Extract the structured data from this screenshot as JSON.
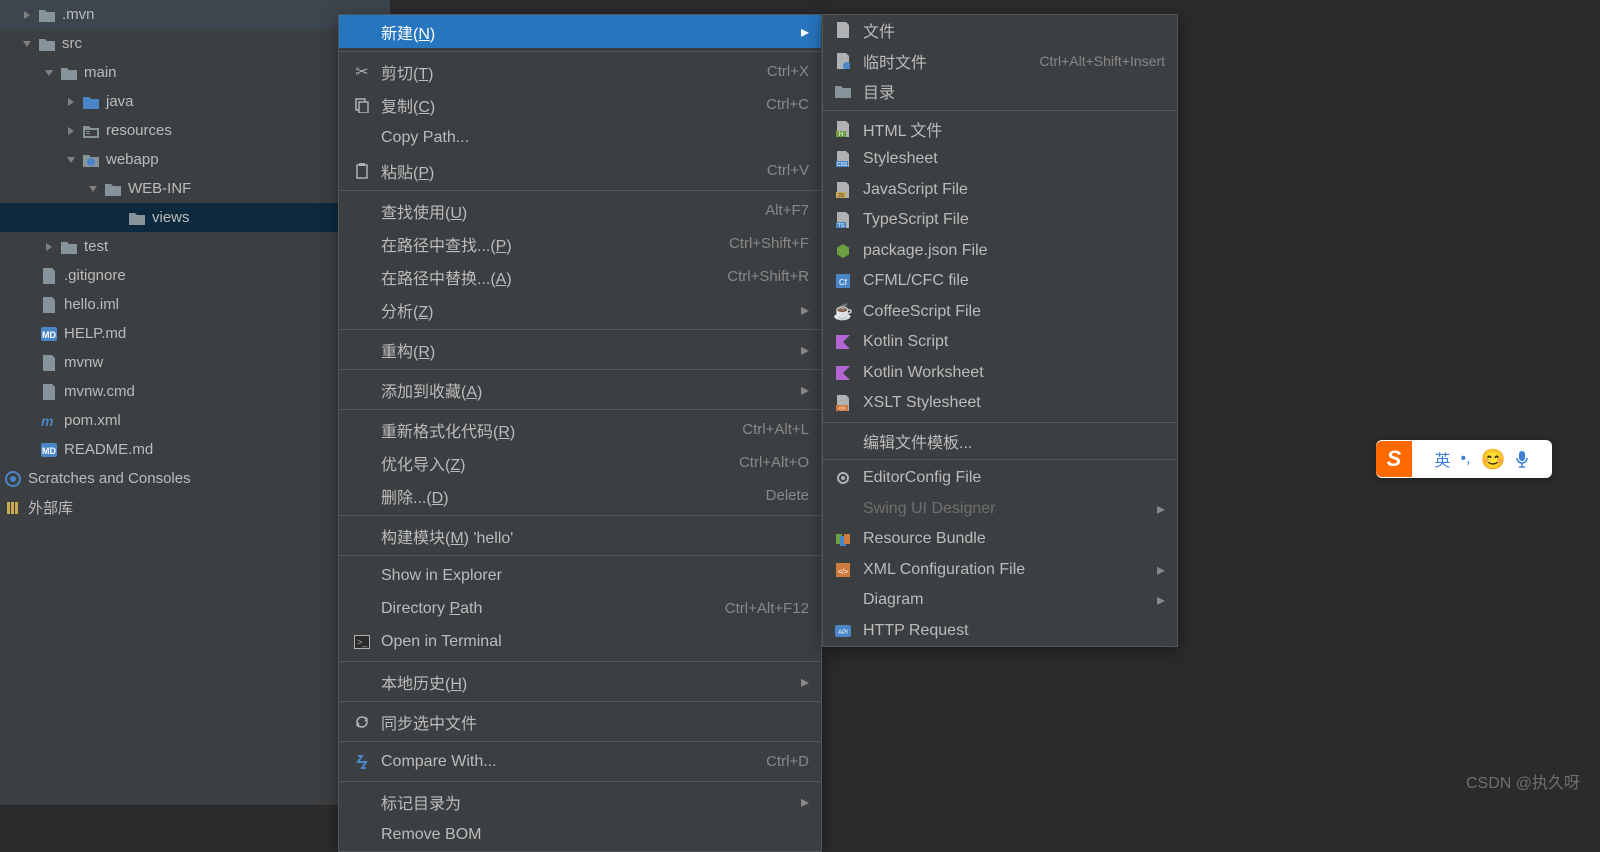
{
  "tree": {
    "mvn": ".mvn",
    "src": "src",
    "main": "main",
    "java": "java",
    "resources": "resources",
    "webapp": "webapp",
    "webinf": "WEB-INF",
    "views": "views",
    "test": "test",
    "gitignore": ".gitignore",
    "helloiml": "hello.iml",
    "helpmd": "HELP.md",
    "mvnw": "mvnw",
    "mvnwcmd": "mvnw.cmd",
    "pomxml": "pom.xml",
    "readme": "README.md",
    "scratches": "Scratches and Consoles",
    "external": "外部库"
  },
  "menu": {
    "new": "新建",
    "new_mn": "N",
    "cut": "剪切",
    "cut_mn": "T",
    "cut_sc": "Ctrl+X",
    "copy": "复制",
    "copy_mn": "C",
    "copy_sc": "Ctrl+C",
    "copypath": "Copy Path...",
    "paste": "粘贴",
    "paste_mn": "P",
    "paste_sc": "Ctrl+V",
    "findusages": "查找使用",
    "findusages_mn": "U",
    "findusages_sc": "Alt+F7",
    "findinpath": "在路径中查找...",
    "findinpath_mn": "P",
    "findinpath_sc": "Ctrl+Shift+F",
    "replaceinpath": "在路径中替换...",
    "replaceinpath_mn": "A",
    "replaceinpath_sc": "Ctrl+Shift+R",
    "analyze": "分析",
    "analyze_mn": "Z",
    "refactor": "重构",
    "refactor_mn": "R",
    "addtofav": "添加到收藏",
    "addtofav_mn": "A",
    "reformat": "重新格式化代码",
    "reformat_mn": "R",
    "reformat_sc": "Ctrl+Alt+L",
    "optimize": "优化导入",
    "optimize_mn": "Z",
    "optimize_sc": "Ctrl+Alt+O",
    "delete": "删除...",
    "delete_mn": "D",
    "delete_sc": "Delete",
    "buildmod": "构建模块",
    "buildmod_mn": "M",
    "buildmod_tail": " 'hello'",
    "showexpl": "Show in Explorer",
    "dirpath": "Directory ",
    "dirpath_mn": "P",
    "dirpath_tail": "ath",
    "dirpath_sc": "Ctrl+Alt+F12",
    "openterm": "Open in Terminal",
    "localhist": "本地历史",
    "localhist_mn": "H",
    "syncsel": "同步选中文件",
    "compare": "Compare With...",
    "compare_sc": "Ctrl+D",
    "markdir": "标记目录为",
    "removebom": "Remove BOM"
  },
  "submenu": {
    "file": "文件",
    "scratch": "临时文件",
    "scratch_sc": "Ctrl+Alt+Shift+Insert",
    "dir": "目录",
    "html": "HTML 文件",
    "stylesheet": "Stylesheet",
    "jsfile": "JavaScript File",
    "tsfile": "TypeScript File",
    "packagejson": "package.json File",
    "cfml": "CFML/CFC file",
    "coffee": "CoffeeScript File",
    "kotlinscript": "Kotlin Script",
    "kotlinws": "Kotlin Worksheet",
    "xslt": "XSLT Stylesheet",
    "edittpl": "编辑文件模板...",
    "editorconfig": "EditorConfig File",
    "swing": "Swing UI Designer",
    "resbundle": "Resource Bundle",
    "xmlconf": "XML Configuration File",
    "diagram": "Diagram",
    "httpreq": "HTTP Request"
  },
  "watermark": "CSDN @执久呀",
  "ime": {
    "logo": "S",
    "lang": "英"
  }
}
